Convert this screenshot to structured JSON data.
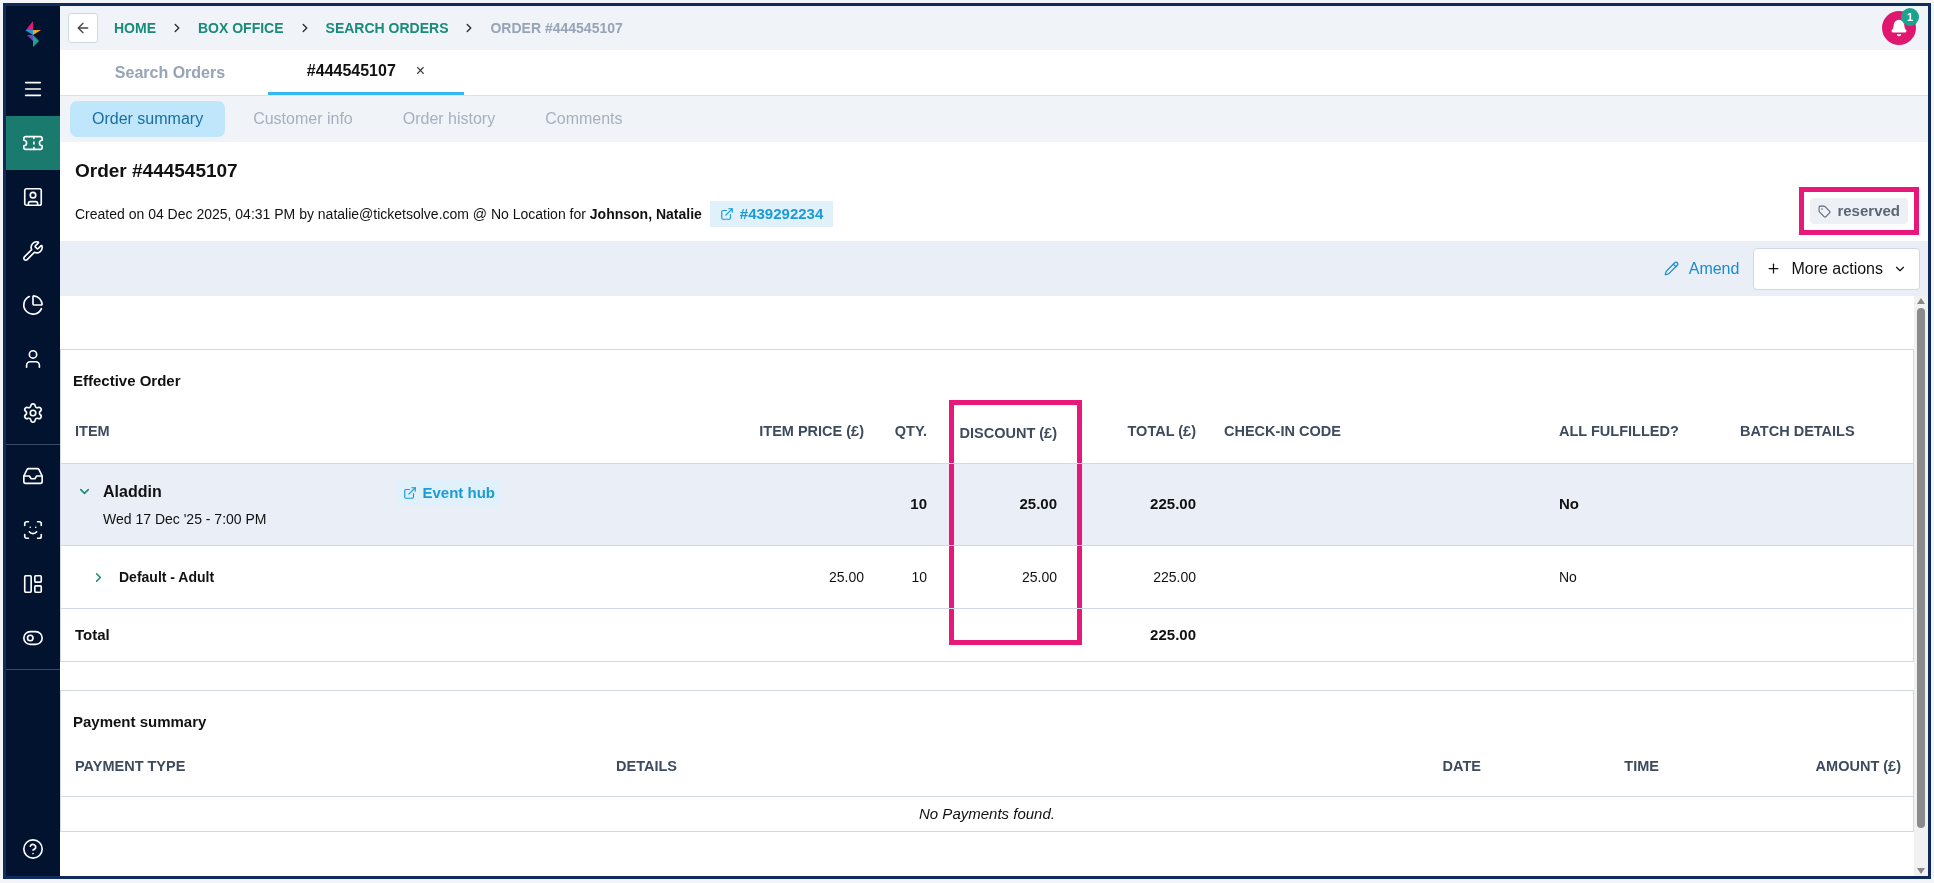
{
  "sidebar": {
    "items": [
      {
        "selected": false
      },
      {
        "selected": true
      },
      {
        "selected": false
      },
      {
        "selected": false
      },
      {
        "selected": false
      },
      {
        "selected": false
      },
      {
        "selected": false
      },
      {
        "selected": false
      },
      {
        "selected": false
      },
      {
        "selected": false
      },
      {
        "selected": false
      }
    ]
  },
  "breadcrumb": [
    {
      "label": "HOME",
      "current": false
    },
    {
      "label": "BOX OFFICE",
      "current": false
    },
    {
      "label": "SEARCH ORDERS",
      "current": false
    },
    {
      "label": "ORDER #444545107",
      "current": true
    }
  ],
  "notifications": {
    "count": "1"
  },
  "tabs": [
    {
      "label": "Search Orders",
      "selected": false
    },
    {
      "label": "#444545107",
      "selected": true,
      "close": "×"
    }
  ],
  "subtabs": [
    {
      "label": "Order summary",
      "selected": true
    },
    {
      "label": "Customer info",
      "selected": false
    },
    {
      "label": "Order history",
      "selected": false
    },
    {
      "label": "Comments",
      "selected": false
    }
  ],
  "order": {
    "title": "Order #444545107",
    "created": "Created on 04 Dec 2025, 04:31 PM by natalie@ticketsolve.com @ No Location for **Johnson, Natalie**",
    "link": "#439292234",
    "status": "reserved",
    "status_highlighted": true
  },
  "actions": {
    "amend": "Amend",
    "more": "More actions"
  },
  "effective_order": {
    "title": "Effective Order",
    "columns": [
      {
        "label": "ITEM",
        "highlighted": false
      },
      {
        "label": "ITEM PRICE (£)",
        "highlighted": false
      },
      {
        "label": "QTY.",
        "highlighted": false
      },
      {
        "label": "DISCOUNT (£)",
        "highlighted": true
      },
      {
        "label": "TOTAL (£)",
        "highlighted": false
      },
      {
        "label": "CHECK-IN CODE",
        "highlighted": false
      },
      {
        "label": "ALL FULFILLED?",
        "highlighted": false
      },
      {
        "label": "BATCH DETAILS",
        "highlighted": false
      }
    ],
    "rows": [
      {
        "kind": "event",
        "expanded": true,
        "name": "Aladdin",
        "date": "Wed 17 Dec '25 - 7:00 PM",
        "link": "Event hub",
        "price": "",
        "qty": "10",
        "discount": "25.00",
        "total": "225.00",
        "fulfilled": "No"
      },
      {
        "kind": "ticket",
        "expanded": false,
        "name": "Default - Adult",
        "price": "25.00",
        "qty": "10",
        "discount": "25.00",
        "total": "225.00",
        "fulfilled": "No"
      }
    ],
    "total": {
      "label": "Total",
      "total": "225.00"
    }
  },
  "payment_summary": {
    "title": "Payment summary",
    "columns": [
      "PAYMENT TYPE",
      "DETAILS",
      "DATE",
      "TIME",
      "AMOUNT (£)"
    ],
    "empty": "No Payments found."
  }
}
